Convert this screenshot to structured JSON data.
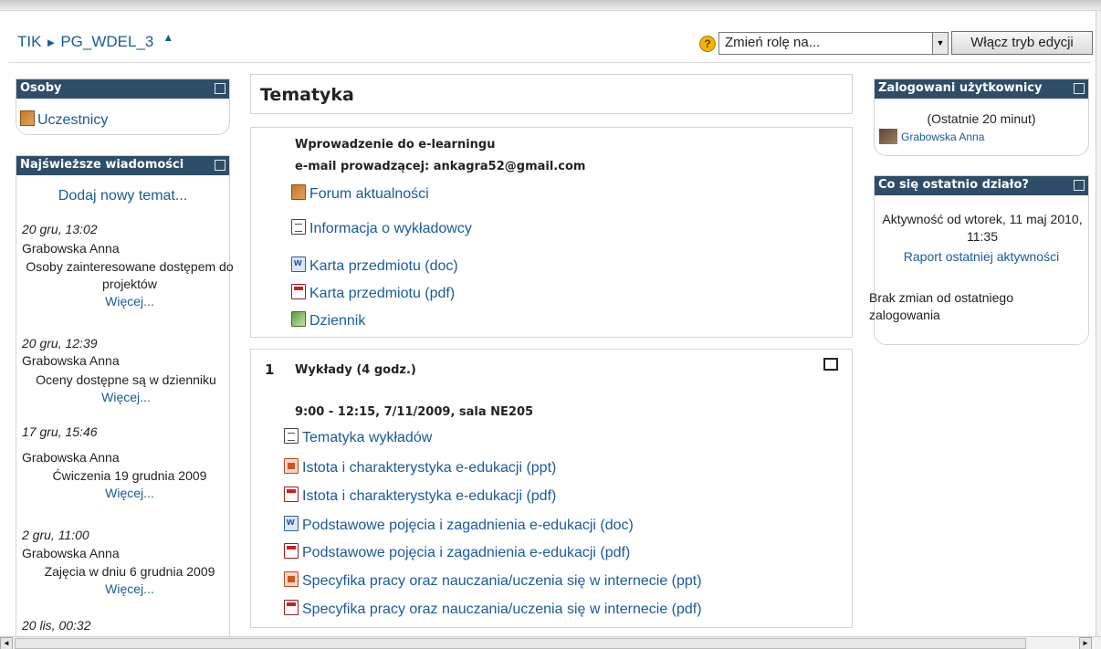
{
  "navbar": {
    "breadcrumb_root": "TIK",
    "breadcrumb_sep": "►",
    "breadcrumb_course": "PG_WDEL_3",
    "hide_arrow": "▲",
    "help_glyph": "?",
    "role_select_value": "Zmień rolę na...",
    "role_select_arrow": "▼",
    "edit_button": "Włącz tryb edycji"
  },
  "left": {
    "people_block": {
      "title": "Osoby",
      "link": "Uczestnicy"
    },
    "news_block": {
      "title": "Najświeższe wiadomości",
      "add_topic": "Dodaj nowy temat...",
      "items": [
        {
          "date": "20 gru, 13:02",
          "author": "Grabowska Anna",
          "text": "Osoby zainteresowane dostępem do projektów",
          "more": "Więcej..."
        },
        {
          "date": "20 gru, 12:39",
          "author": "Grabowska Anna",
          "text": "Oceny dostępne są w dzienniku",
          "more": "Więcej..."
        },
        {
          "date": "17 gru, 15:46",
          "author": "Grabowska Anna",
          "text": "Ćwiczenia 19 grudnia 2009",
          "more": "Więcej..."
        },
        {
          "date": "2 gru, 11:00",
          "author": "Grabowska Anna",
          "text": "Zajęcia w dniu 6 grudnia 2009",
          "more": "Więcej..."
        },
        {
          "date": "20 lis, 00:32"
        }
      ]
    }
  },
  "main": {
    "course_title": "Tematyka",
    "section0": {
      "heading1": "Wprowadzenie do e-learningu",
      "heading2": "e-mail prowadzącej: ankagra52@gmail.com",
      "resources": [
        {
          "icon": "forum-icon",
          "label": "Forum aktualności"
        },
        {
          "icon": "page-icon",
          "label": "Informacja o wykładowcy"
        },
        {
          "icon": "word-doc-icon",
          "label": "Karta przedmiotu (doc)"
        },
        {
          "icon": "pdf-icon",
          "label": "Karta przedmiotu (pdf)"
        },
        {
          "icon": "gradebook-icon",
          "label": "Dziennik"
        }
      ]
    },
    "section1": {
      "number": "1",
      "title": "Wykłady (4 godz.)",
      "subtitle": "9:00 - 12:15, 7/11/2009, sala NE205",
      "resources": [
        {
          "icon": "page-icon",
          "label": "Tematyka wykładów"
        },
        {
          "icon": "ppt-icon",
          "label": "Istota i charakterystyka e-edukacji (ppt)"
        },
        {
          "icon": "pdf-icon",
          "label": "Istota i charakterystyka e-edukacji (pdf)"
        },
        {
          "icon": "word-doc-icon",
          "label": "Podstawowe pojęcia i zagadnienia e-edukacji (doc)"
        },
        {
          "icon": "pdf-icon",
          "label": "Podstawowe pojęcia i zagadnienia e-edukacji (pdf)"
        },
        {
          "icon": "ppt-icon",
          "label": "Specyfika pracy oraz nauczania/uczenia się w internecie (ppt)"
        },
        {
          "icon": "pdf-icon",
          "label": "Specyfika pracy oraz nauczania/uczenia się w internecie (pdf)"
        }
      ]
    }
  },
  "right": {
    "online_block": {
      "title": "Zalogowani użytkownicy",
      "period": "(Ostatnie 20 minut)",
      "user": "Grabowska Anna"
    },
    "recent_block": {
      "title": "Co się ostatnio działo?",
      "activity_since": "Aktywność od wtorek, 11 maj 2010, 11:35",
      "report_link": "Raport ostatniej aktywności",
      "no_changes": "Brak zmian od ostatniego zalogowania"
    }
  },
  "scrollbar": {
    "left_arrow": "◄",
    "right_arrow": "►"
  }
}
